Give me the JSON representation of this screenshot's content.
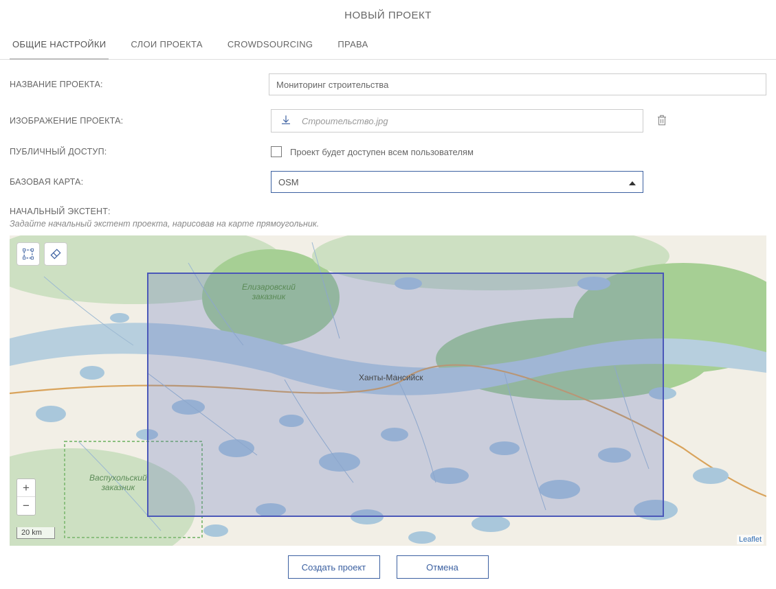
{
  "header": {
    "title": "НОВЫЙ ПРОЕКТ"
  },
  "tabs": [
    {
      "label": "ОБЩИЕ НАСТРОЙКИ",
      "active": true
    },
    {
      "label": "СЛОИ ПРОЕКТА",
      "active": false
    },
    {
      "label": "CROWDSOURCING",
      "active": false
    },
    {
      "label": "ПРАВА",
      "active": false
    }
  ],
  "form": {
    "name_label": "НАЗВАНИЕ ПРОЕКТА:",
    "name_value": "Мониторинг строительства",
    "image_label": "ИЗОБРАЖЕНИЕ ПРОЕКТА:",
    "image_placeholder": "Строительство.jpg",
    "public_label": "ПУБЛИЧНЫЙ ДОСТУП:",
    "public_checkbox_label": "Проект будет доступен всем пользователям",
    "public_checked": false,
    "basemap_label": "БАЗОВАЯ КАРТА:",
    "basemap_value": "OSM"
  },
  "extent": {
    "title": "НАЧАЛЬНЫЙ ЭКСТЕНТ:",
    "hint": "Задайте начальный экстент проекта, нарисовав на карте прямоугольник."
  },
  "map": {
    "city": "Ханты-Мансийск",
    "reserve1_line1": "Елизаровский",
    "reserve1_line2": "заказник",
    "reserve2_line1": "Васпухольский",
    "reserve2_line2": "заказник",
    "scale": "20 km",
    "attribution": "Leaflet"
  },
  "footer": {
    "submit": "Создать проект",
    "cancel": "Отмена"
  }
}
